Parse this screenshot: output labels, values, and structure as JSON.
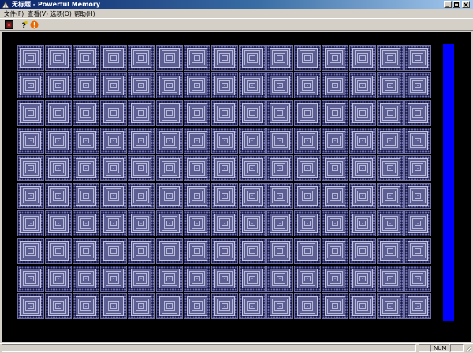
{
  "window": {
    "title": "无标题 - Powerful Memory",
    "controls": [
      "minimize-icon",
      "maximize-icon",
      "close-icon"
    ]
  },
  "menu": [
    {
      "label": "文件(F)"
    },
    {
      "label": "查看(V)"
    },
    {
      "label": "选项(O)"
    },
    {
      "label": "帮助(H)"
    }
  ],
  "toolbar": {
    "tools": [
      {
        "icon": "new-game-icon"
      },
      {
        "icon": "help-question-icon"
      },
      {
        "icon": "info-alert-icon"
      }
    ]
  },
  "board": {
    "rows": 10,
    "cols": 15,
    "tile_state": "face-down",
    "tile_colors": {
      "dark": "#525486",
      "light": "#a8aad0"
    }
  },
  "time_bar": {
    "fraction_remaining": 1.0,
    "color": "#0000ff"
  },
  "status": {
    "main_text": "",
    "caps": "",
    "num": "NUM",
    "scroll": ""
  }
}
